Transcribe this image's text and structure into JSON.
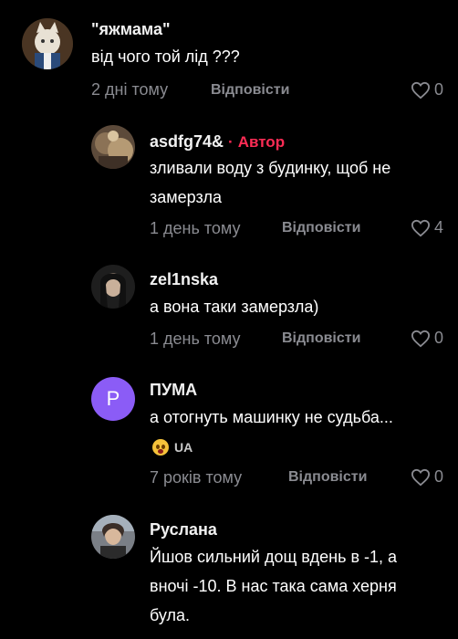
{
  "comments": [
    {
      "username": "\"яжмама\"",
      "text": [
        "від чого той лід ???"
      ],
      "time": "2 дні тому",
      "reply_label": "Відповісти",
      "likes": "0"
    },
    {
      "username": "asdfg74&",
      "author_sep": "·",
      "author_label": "Автор",
      "text": [
        "зливали воду з будинку, щоб не",
        "замерзла"
      ],
      "time": "1 день тому",
      "reply_label": "Відповісти",
      "likes": "4"
    },
    {
      "username": "zel1nska",
      "text": [
        "а вона таки замерзла)"
      ],
      "time": "1 день тому",
      "reply_label": "Відповісти",
      "likes": "0"
    },
    {
      "username": "ПУМА",
      "avatar_letter": "P",
      "text": [
        "а отогнуть машинку не судьба..."
      ],
      "reaction_label": "UA",
      "time": "7 років тому",
      "reply_label": "Відповісти",
      "likes": "0"
    },
    {
      "username": "Руслана",
      "text": [
        "Йшов сильний дощ вдень в -1, а",
        "вночі -10. В нас така сама херня",
        "була."
      ]
    }
  ],
  "icons": {
    "like": "heart-outline-icon",
    "reaction": "screaming-face-emoji"
  },
  "colors": {
    "background": "#000000",
    "author_accent": "#fe2c55",
    "muted_text": "#8a8b91",
    "letter_avatar": "#8b5cf6"
  }
}
